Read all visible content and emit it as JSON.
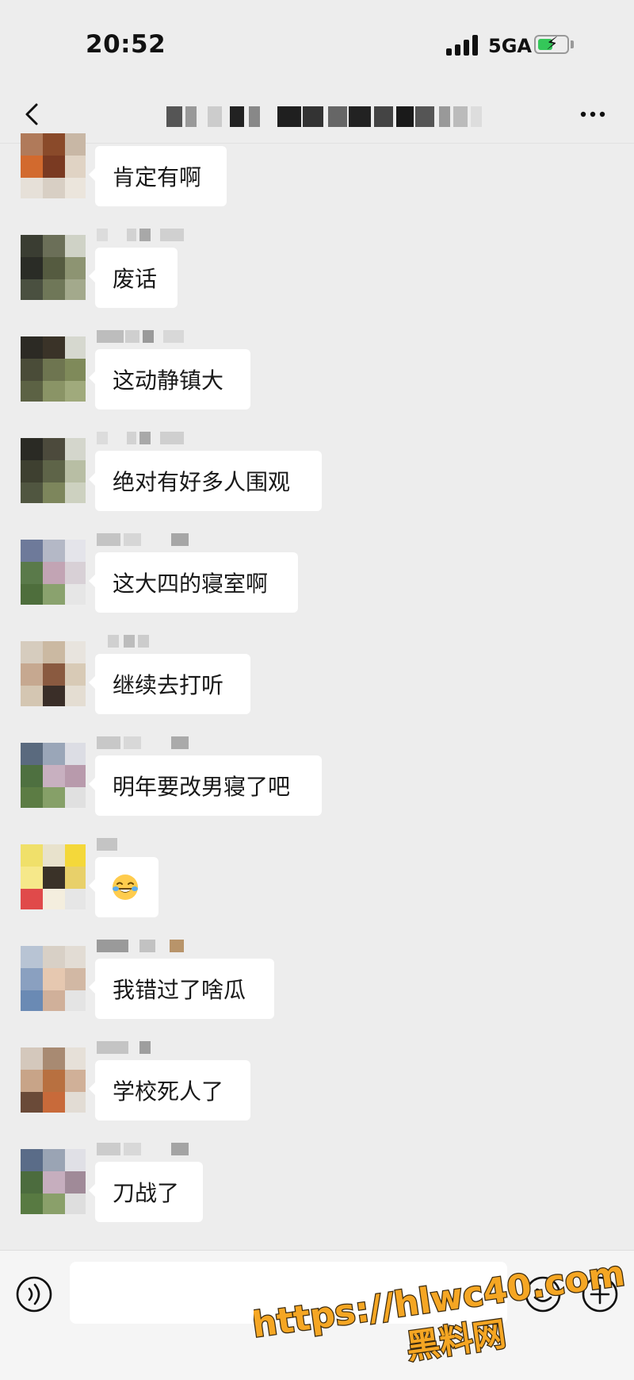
{
  "status_bar": {
    "time": "20:52",
    "network": "5GA"
  },
  "nav": {
    "title": ""
  },
  "messages": [
    {
      "text": "肯定有啊"
    },
    {
      "text": "废话"
    },
    {
      "text": "这动静镇大"
    },
    {
      "text": "绝对有好多人围观"
    },
    {
      "text": "这大四的寝室啊"
    },
    {
      "text": "继续去打听"
    },
    {
      "text": "明年要改男寝了吧"
    },
    {
      "text": "",
      "emoji": "tears-of-joy-emoji"
    },
    {
      "text": "我错过了啥瓜"
    },
    {
      "text": "学校死人了"
    },
    {
      "text": "刀战了"
    }
  ],
  "input_bar": {
    "placeholder": ""
  },
  "watermark": {
    "url": "https://hlwc40.com",
    "site": "黑料网"
  },
  "colors": {
    "background": "#ededed",
    "bubble": "#ffffff",
    "battery": "#34c759",
    "watermark": "#f5a623"
  }
}
